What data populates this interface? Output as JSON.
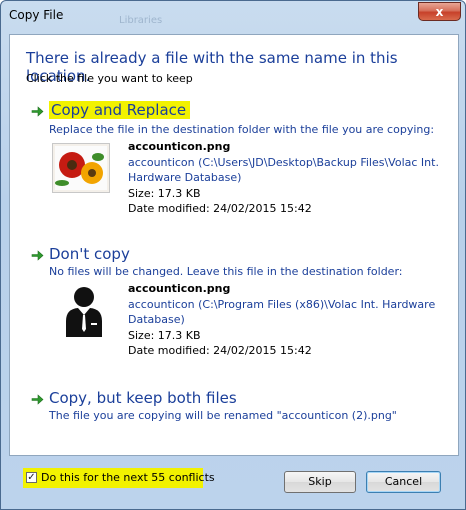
{
  "window": {
    "title": "Copy File",
    "background_label": "Libraries",
    "close_label": "x"
  },
  "dialog": {
    "heading": "There is already a file with the same name in this location.",
    "subheading": "Click the file you want to keep"
  },
  "options": {
    "replace": {
      "title": "Copy and Replace",
      "description": "Replace the file in the destination folder with the file you are copying:",
      "file": {
        "name": "accounticon.png",
        "path_line1": "accounticon (C:\\Users\\JD\\Desktop\\Backup Files\\Volac Int.",
        "path_line2": "Hardware Database)",
        "size": "Size: 17.3 KB",
        "modified": "Date modified: 24/02/2015 15:42",
        "icon": "flowers-thumbnail-icon"
      }
    },
    "dont_copy": {
      "title": "Don't copy",
      "description": "No files will be changed. Leave this file in the destination folder:",
      "file": {
        "name": "accounticon.png",
        "path_line1": "accounticon (C:\\Program Files (x86)\\Volac Int. Hardware",
        "path_line2": "Database)",
        "size": "Size: 17.3 KB",
        "modified": "Date modified: 24/02/2015 15:42",
        "icon": "user-account-icon"
      }
    },
    "keep_both": {
      "title": "Copy, but keep both files",
      "description": "The file you are copying will be renamed \"accounticon (2).png\""
    }
  },
  "footer": {
    "checkbox_label": "Do this for the next 55 conflicts",
    "checkbox_checked": true,
    "skip_label": "Skip",
    "cancel_label": "Cancel"
  },
  "colors": {
    "accent_text": "#1b3f9a",
    "highlight": "#f2f200",
    "arrow_green": "#2e9a2e"
  }
}
